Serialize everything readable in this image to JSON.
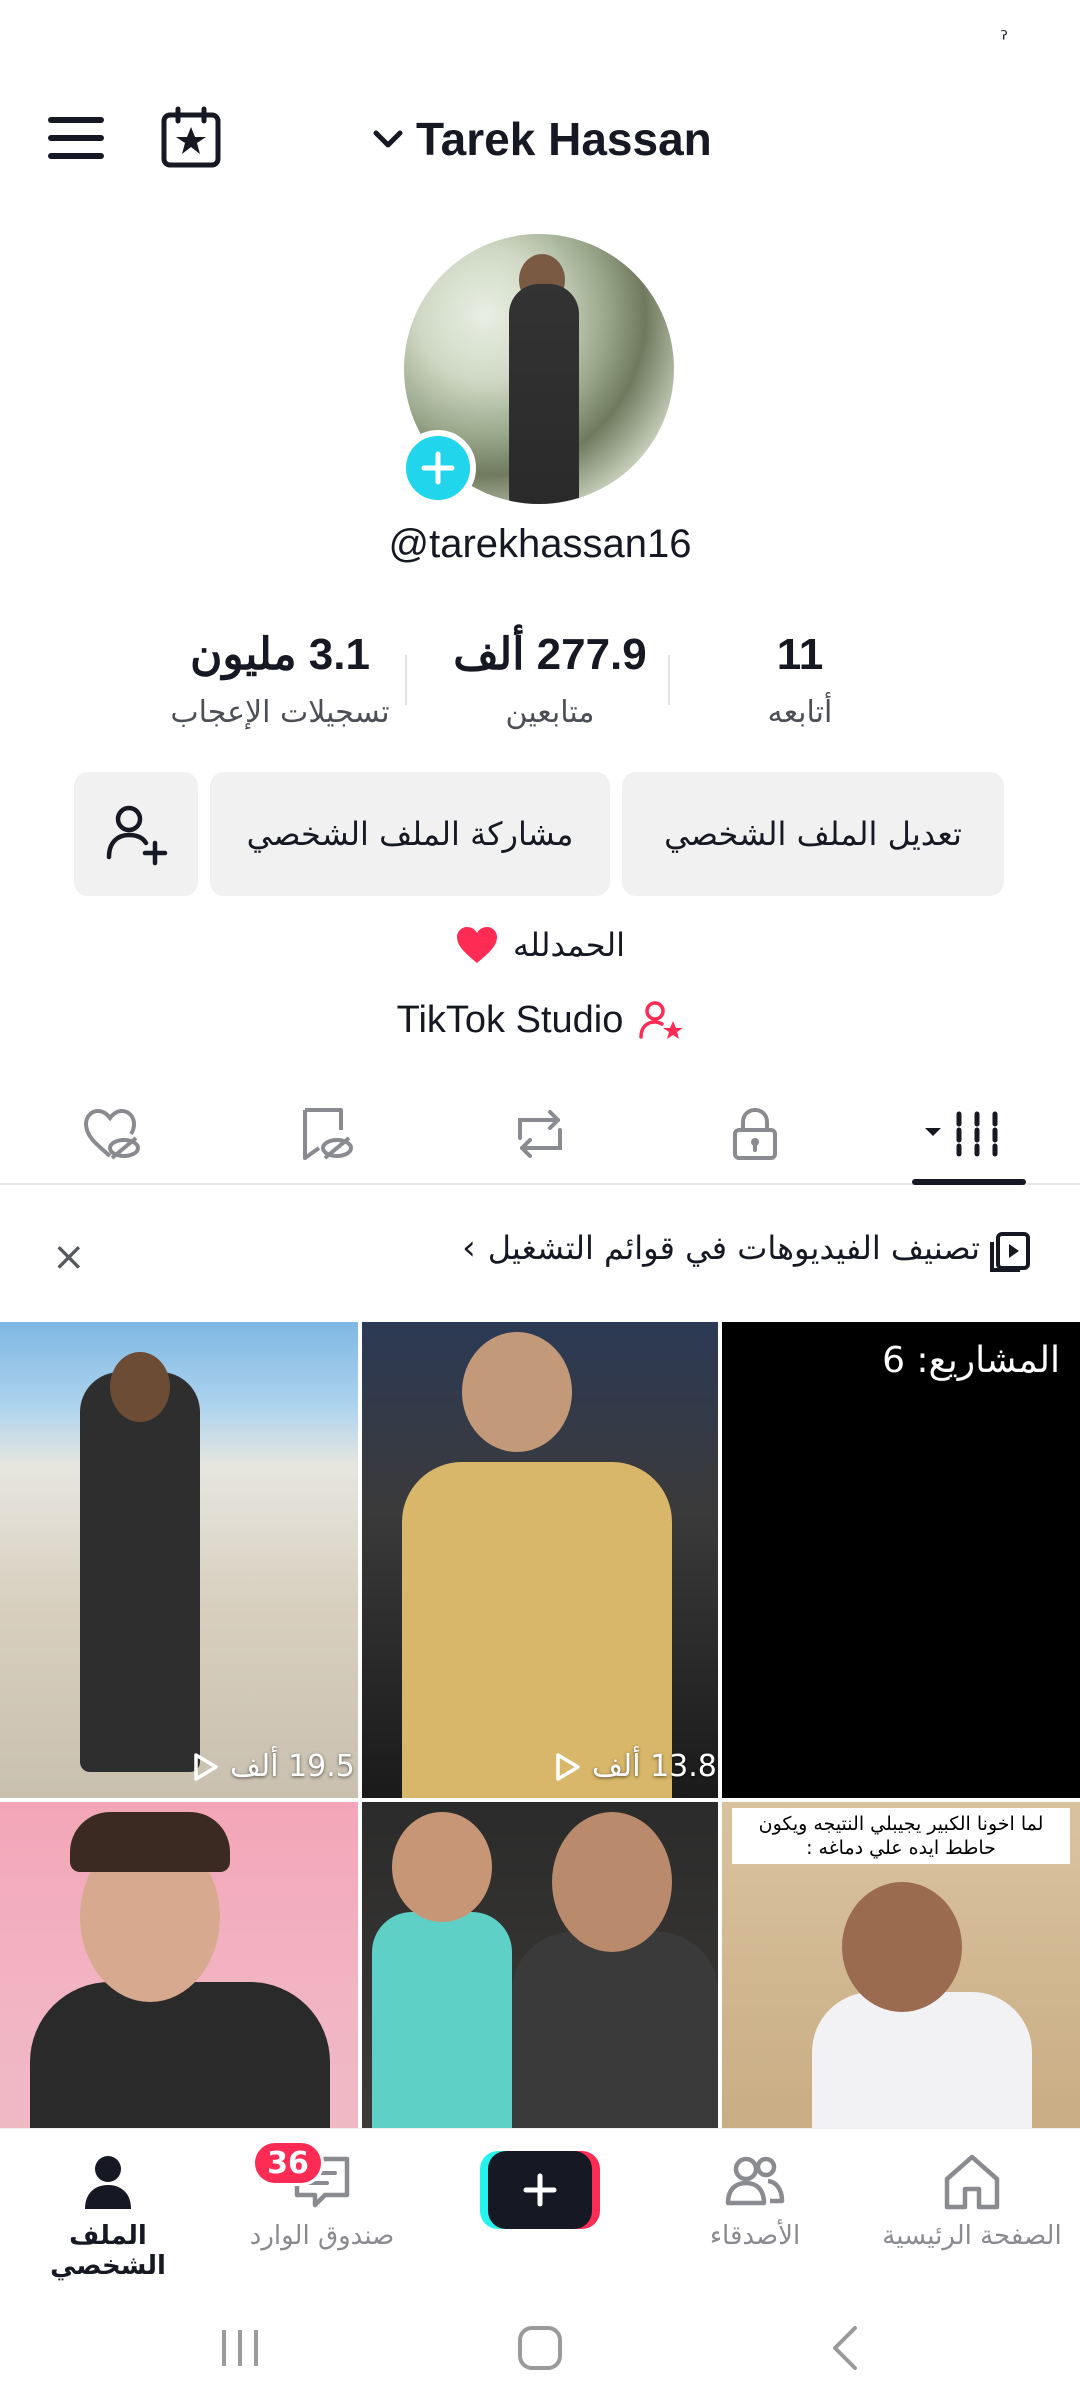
{
  "status": {
    "indicator": "ˀ"
  },
  "header": {
    "username": "Tarek Hassan"
  },
  "profile": {
    "handle": "@tarekhassan16",
    "stats": [
      {
        "value": "3.1 مليون",
        "label": "تسجيلات الإعجاب"
      },
      {
        "value": "277.9 ألف",
        "label": "متابعين"
      },
      {
        "value": "11",
        "label": "أتابعه"
      }
    ],
    "buttons": {
      "edit": "تعديل الملف الشخصي",
      "share": "مشاركة الملف الشخصي"
    },
    "bio": "الحمدلله",
    "studio": "TikTok Studio"
  },
  "banner": {
    "text": "تصنيف الفيديوهات في قوائم التشغيل",
    "close": "×"
  },
  "videos": [
    {
      "views": "19.5 ألف"
    },
    {
      "views": "13.8 ألف"
    },
    {
      "projects": "المشاريع: 6"
    },
    {
      "views": ""
    },
    {
      "views": ""
    },
    {
      "caption": "لما اخونا الكبير يجيبلي النتيجه ويكون حاطط ايده علي دماغه :"
    }
  ],
  "bottom_nav": {
    "profile": "الملف الشخصي",
    "inbox": "صندوق الوارد",
    "inbox_badge": "36",
    "friends": "الأصدقاء",
    "home": "الصفحة الرئيسية"
  },
  "colors": {
    "accent_red": "#fe2c55",
    "accent_cyan": "#20d5ec",
    "text": "#161823"
  }
}
